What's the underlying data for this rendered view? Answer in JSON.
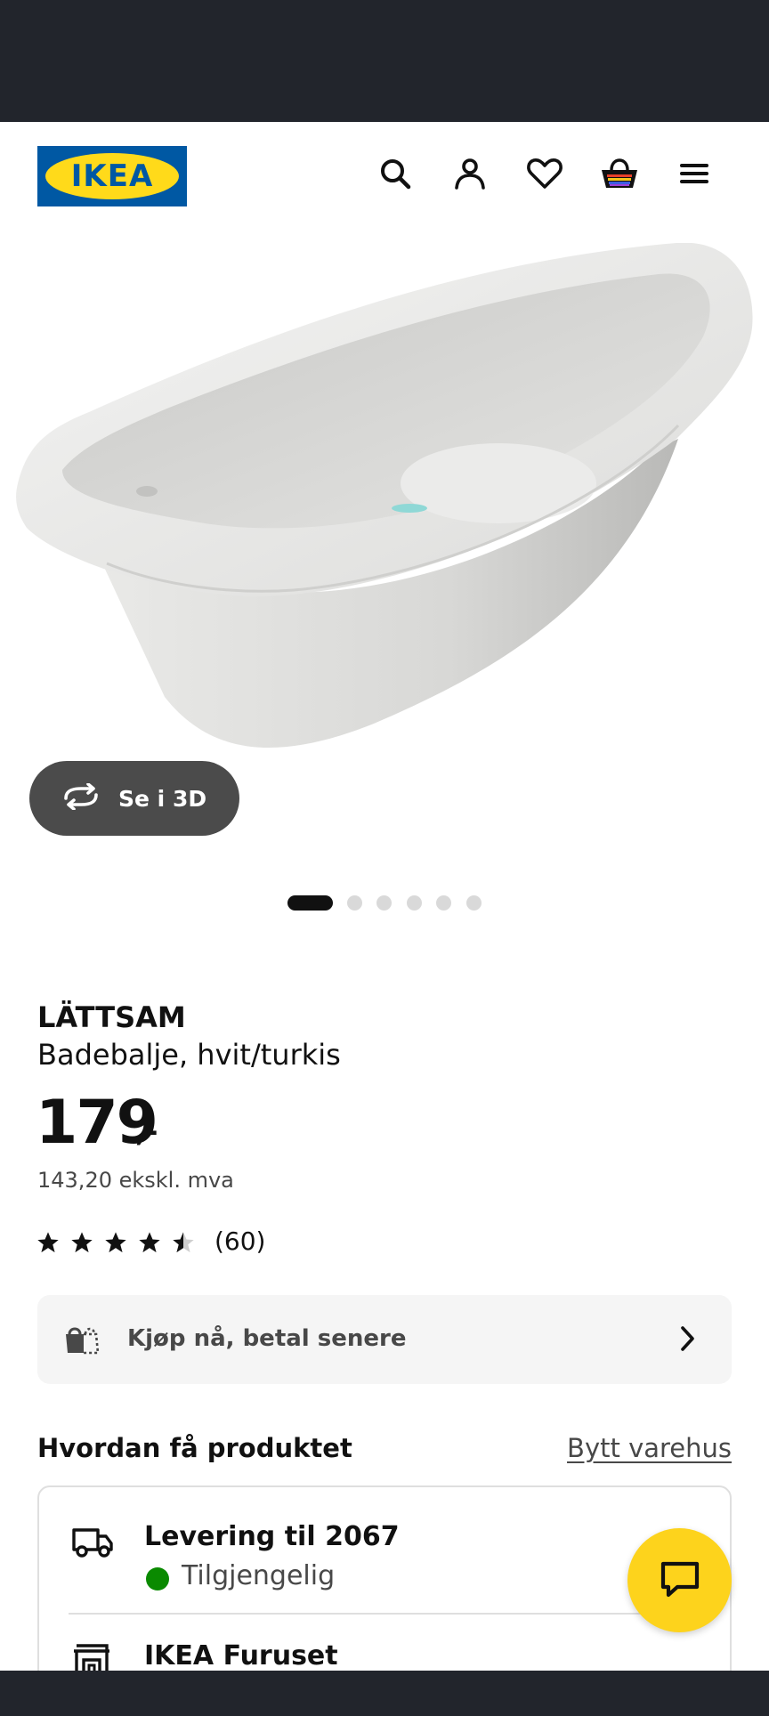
{
  "header": {
    "logo_text": "IKEA",
    "icons": [
      "search-icon",
      "account-icon",
      "favourites-icon",
      "cart-icon",
      "menu-icon"
    ]
  },
  "gallery": {
    "view_3d_label": "Se i 3D",
    "slide_count": 6,
    "active_slide": 1
  },
  "product": {
    "brand": "LÄTTSAM",
    "description": "Badebalje, hvit/turkis",
    "price": "179",
    "price_suffix": ",-",
    "price_ex_vat": "143,20 ekskl. mva",
    "rating": 4.5,
    "review_count": "(60)"
  },
  "financing": {
    "label": "Kjøp nå, betal senere"
  },
  "availability": {
    "title": "Hvordan få produktet",
    "change_store_label": "Bytt varehus",
    "delivery_title": "Levering til 2067",
    "delivery_status": "Tilgjengelig",
    "store_name": "IKEA Furuset"
  },
  "colors": {
    "status_bar": "#22252c",
    "ikea_blue": "#0058a3",
    "ikea_yellow": "#ffda1a",
    "chat_button": "#fdd31c",
    "available_green": "#0a8a00"
  }
}
